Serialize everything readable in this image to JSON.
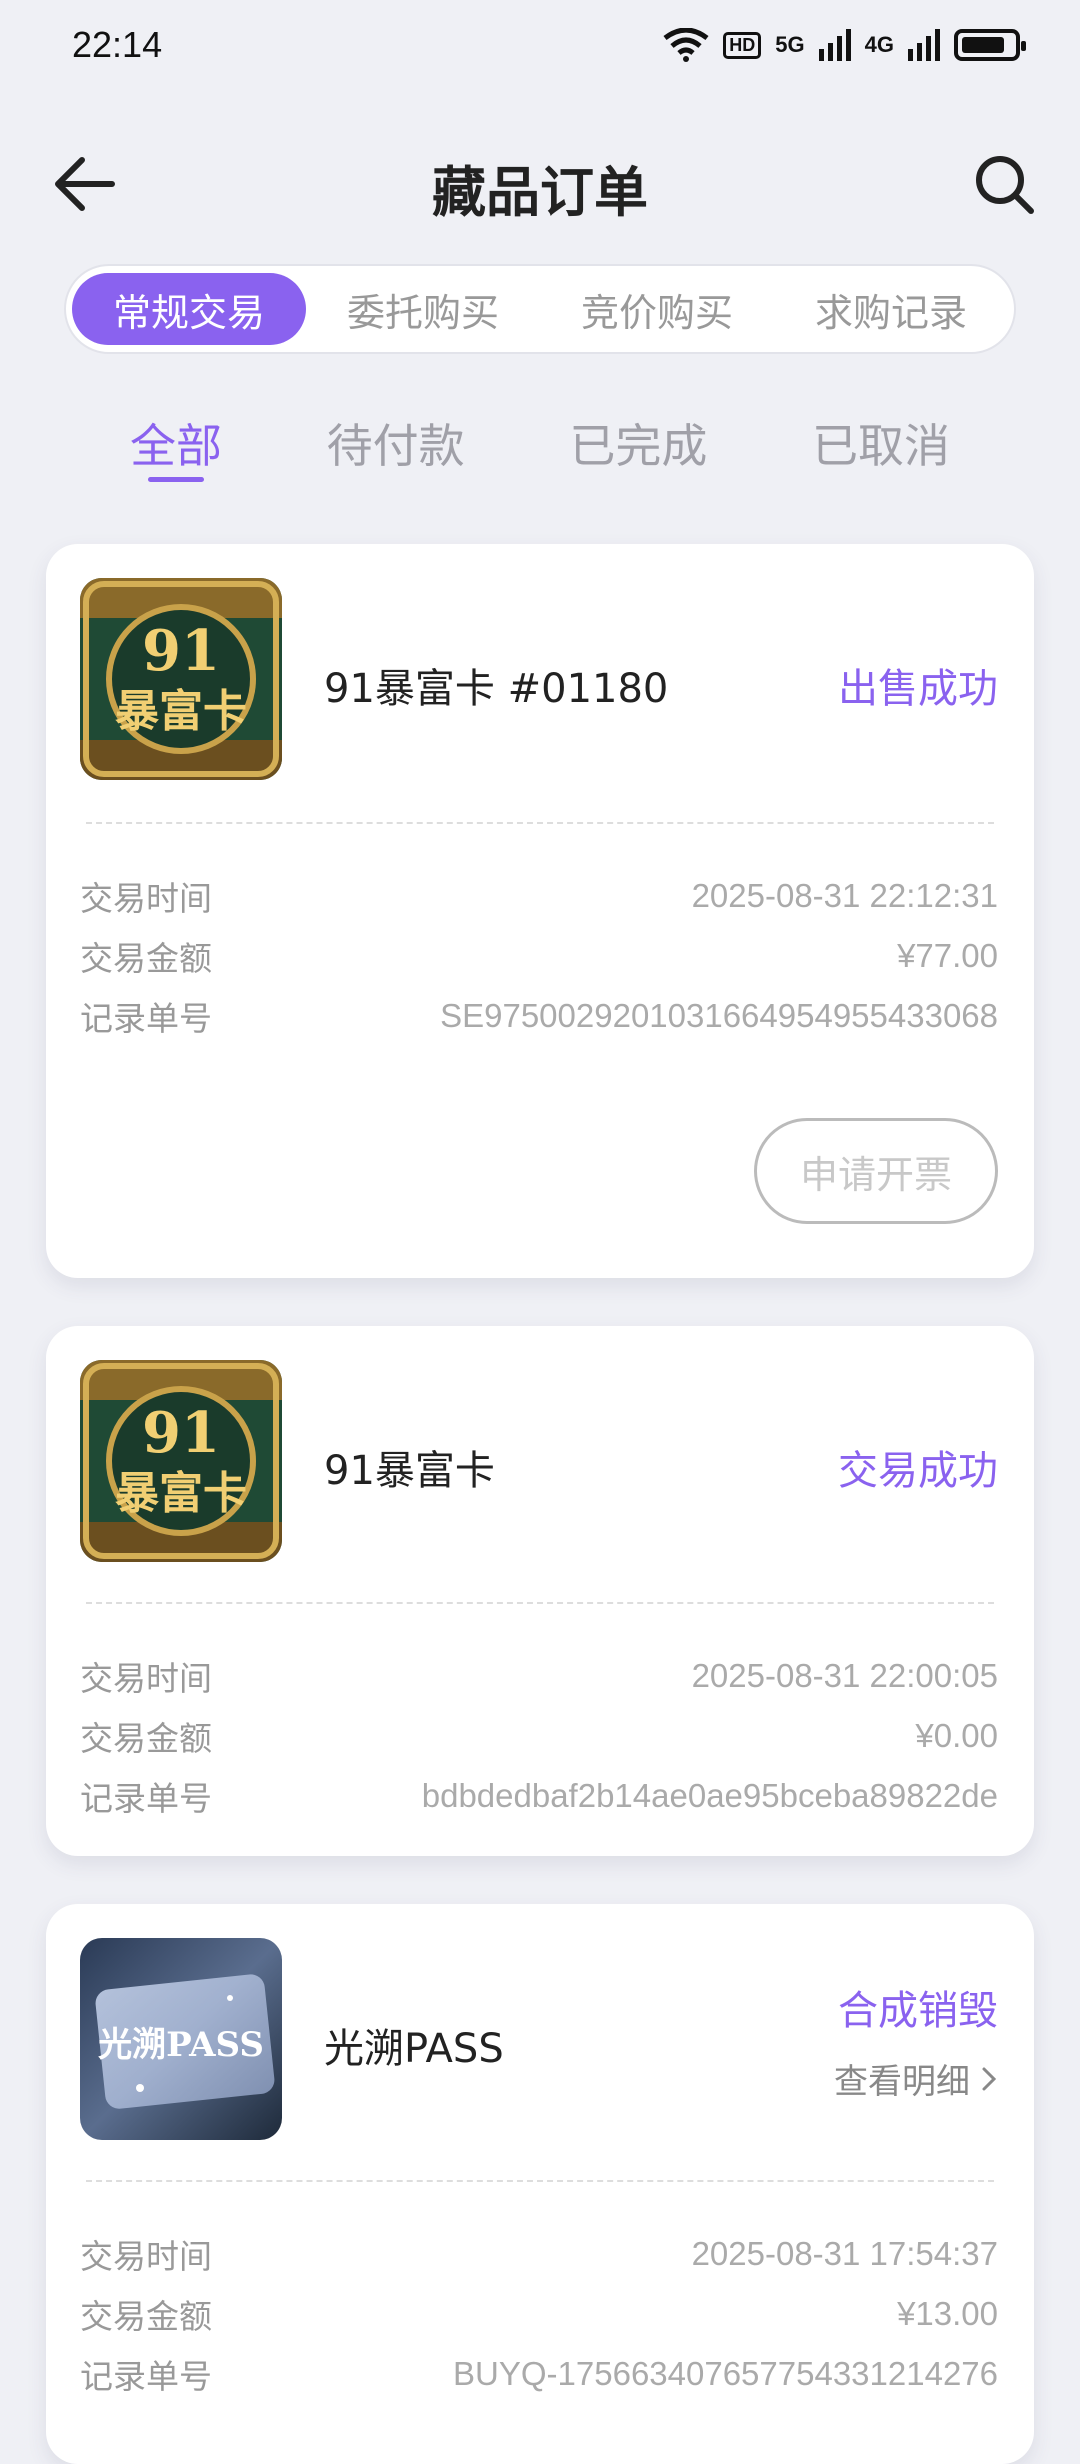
{
  "status_bar": {
    "time": "22:14",
    "hd": "HD",
    "net1": "5G",
    "net2": "4G"
  },
  "header": {
    "title": "藏品订单"
  },
  "segments": [
    "常规交易",
    "委托购买",
    "竞价购买",
    "求购记录"
  ],
  "subtabs": [
    "全部",
    "待付款",
    "已完成",
    "已取消"
  ],
  "labels": {
    "time": "交易时间",
    "amount": "交易金额",
    "order_no": "记录单号"
  },
  "orders": [
    {
      "title": "91暴富卡  #01180",
      "status": "出售成功",
      "time": "2025-08-31 22:12:31",
      "amount": "¥77.00",
      "order_no": "SE9750029201031664954955433068",
      "action": "申请开票",
      "thumb_text": [
        "91",
        "暴富卡"
      ]
    },
    {
      "title": "91暴富卡",
      "status": "交易成功",
      "time": "2025-08-31 22:00:05",
      "amount": "¥0.00",
      "order_no": "bdbdedbaf2b14ae0ae95bceba89822de",
      "thumb_text": [
        "91",
        "暴富卡"
      ]
    },
    {
      "title": "光溯PASS",
      "status": "合成销毁",
      "detail": "查看明细",
      "time": "2025-08-31 17:54:37",
      "amount": "¥13.00",
      "order_no": "BUYQ-1756634076577543312142​76",
      "thumb_text": [
        "光溯PASS"
      ]
    }
  ],
  "colors": {
    "accent": "#8a62ef",
    "background": "#eff0f5"
  }
}
